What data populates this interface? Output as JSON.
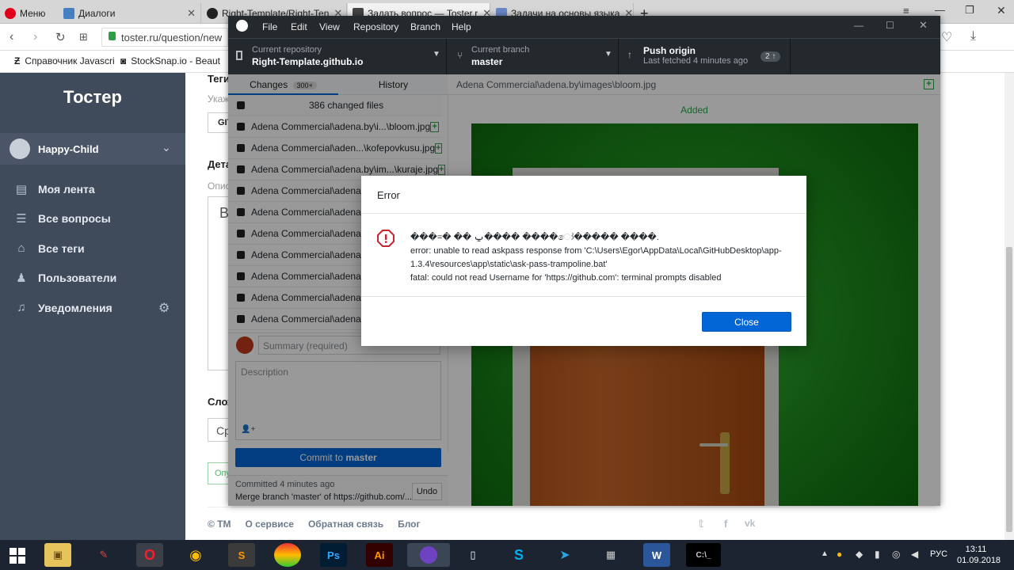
{
  "browser": {
    "menu_label": "Меню",
    "tabs": [
      {
        "title": "Диалоги",
        "color": "#4680c2"
      },
      {
        "title": "Right-Template/Right-Ten",
        "color": "#222"
      },
      {
        "title": "Задать вопрос — Toster.r",
        "color": "#444"
      },
      {
        "title": "Задачи на основы языка",
        "color": "#6a87c9"
      }
    ],
    "url": "toster.ru/question/new",
    "bookmarks": [
      "Справочник Javascri",
      "StockSnap.io - Beaut"
    ]
  },
  "toster": {
    "logo": "Тостер",
    "user": "Happy-Child",
    "nav": [
      {
        "label": "Моя лента",
        "icon": "doc-icon"
      },
      {
        "label": "Все вопросы",
        "icon": "list-icon"
      },
      {
        "label": "Все теги",
        "icon": "tag-icon"
      },
      {
        "label": "Пользователи",
        "icon": "users-icon"
      },
      {
        "label": "Уведомления",
        "icon": "bell-icon"
      }
    ],
    "fragments": {
      "tags_h": "Теги",
      "tags_hint": "Укаж",
      "tag_chip": "GIT",
      "details_h": "Дета",
      "details_hint": "Опис",
      "details_text": "В",
      "complexity_h": "Слож",
      "complexity_val": "Ср",
      "publish": "Опу"
    },
    "footer": [
      "© ТМ",
      "О сервисе",
      "Обратная связь",
      "Блог"
    ]
  },
  "github": {
    "menu": [
      "File",
      "Edit",
      "View",
      "Repository",
      "Branch",
      "Help"
    ],
    "repo_label": "Current repository",
    "repo_name": "Right-Template.github.io",
    "branch_label": "Current branch",
    "branch_name": "master",
    "push_label": "Push origin",
    "push_sub": "Last fetched 4 minutes ago",
    "push_badge": "2",
    "tab_changes": "Changes",
    "changes_badge": "300+",
    "tab_history": "History",
    "changed_files": "386 changed files",
    "files": [
      "Adena Commercial\\adena.by\\i...\\bloom.jpg",
      "Adena Commercial\\aden...\\kofepovkusu.jpg",
      "Adena Commercial\\adena.by\\im...\\kuraje.jpg",
      "Adena Commercial\\adena.by",
      "Adena Commercial\\adena.by",
      "Adena Commercial\\adena.b",
      "Adena Commercial\\adena.b",
      "Adena Commercial\\adena.b",
      "Adena Commercial\\adena...",
      "Adena Commercial\\adena.by"
    ],
    "summary_ph": "Summary (required)",
    "description_ph": "Description",
    "commit_prefix": "Commit to ",
    "commit_branch": "master",
    "committed": "Committed 4 minutes ago",
    "commit_msg": "Merge branch 'master' of https://github.com/...",
    "undo": "Undo",
    "diff_path": "Adena Commercial\\adena.by\\images\\bloom.jpg",
    "diff_status": "Added"
  },
  "dialog": {
    "title": "Error",
    "line1": "���=� �� ݐ���� ����ෝ����� ����.",
    "line2": "error: unable to read askpass response from 'C:\\Users\\Egor\\AppData\\Local\\GitHubDesktop\\app-1.3.4\\resources\\app\\static\\ask-pass-trampoline.bat'",
    "line3": "fatal: could not read Username for 'https://github.com': terminal prompts disabled",
    "close": "Close"
  },
  "taskbar": {
    "lang": "РУС",
    "time": "13:11",
    "date": "01.09.2018"
  }
}
